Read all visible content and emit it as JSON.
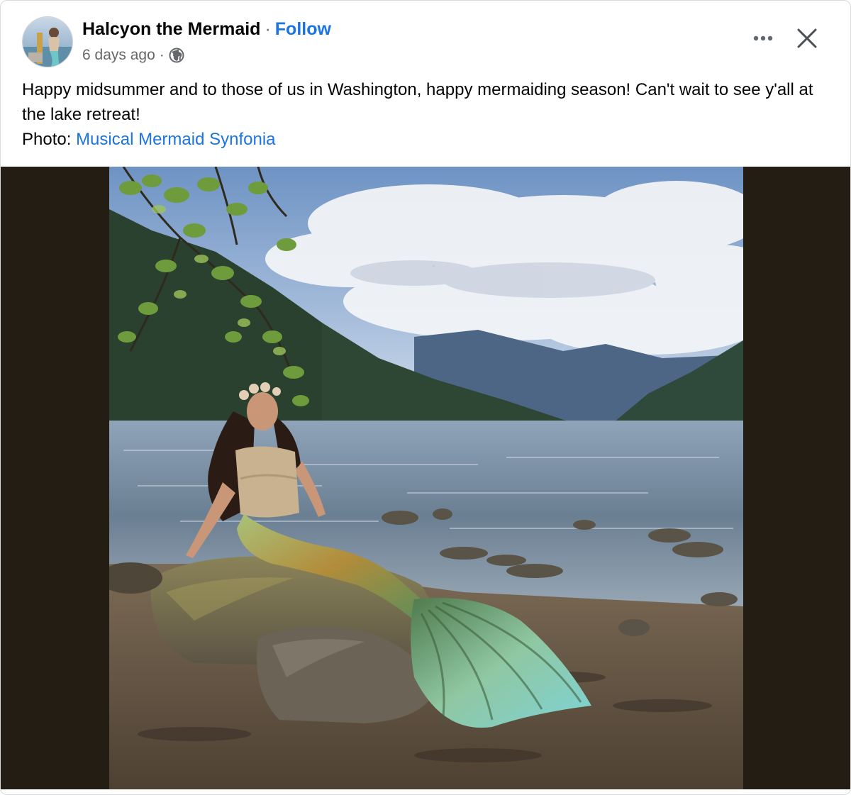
{
  "author": {
    "name": "Halcyon the Mermaid",
    "separator": "·",
    "follow_label": "Follow"
  },
  "meta": {
    "time": "6 days ago",
    "separator": "·",
    "audience_icon": "globe-icon"
  },
  "actions": {
    "more_icon": "more-horizontal-icon",
    "close_icon": "close-icon"
  },
  "post": {
    "text": "Happy midsummer and to those of us in Washington, happy mermaiding season! Can't wait to see y'all at the lake retreat!",
    "photo_credit_prefix": "Photo: ",
    "photo_credit_name": "Musical Mermaid Synfonia"
  },
  "colors": {
    "link": "#1b74e4",
    "secondary_text": "#65676b",
    "photo_letterbox": "#231d14"
  }
}
